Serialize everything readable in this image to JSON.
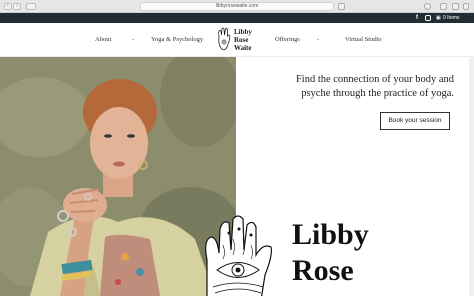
{
  "browser": {
    "url": "libbyrosewaite.com",
    "back_icon": "chevron-left-icon",
    "forward_icon": "chevron-right-icon"
  },
  "topbar": {
    "facebook": "f",
    "cart_label": "0 Items"
  },
  "nav": {
    "about": "About",
    "yoga": "Yoga & Psychology",
    "offerings": "Offerings",
    "virtual": "Virtual Studio"
  },
  "logo": {
    "line1": "Libby",
    "line2": "Rose",
    "line3": "Waite"
  },
  "hero": {
    "tagline": "Find the connection of your body and psyche through the practice of yoga.",
    "cta_label": "Book your session",
    "name_line1": "Libby",
    "name_line2": "Rose"
  },
  "colors": {
    "topbar": "#222c33",
    "text": "#222222"
  }
}
